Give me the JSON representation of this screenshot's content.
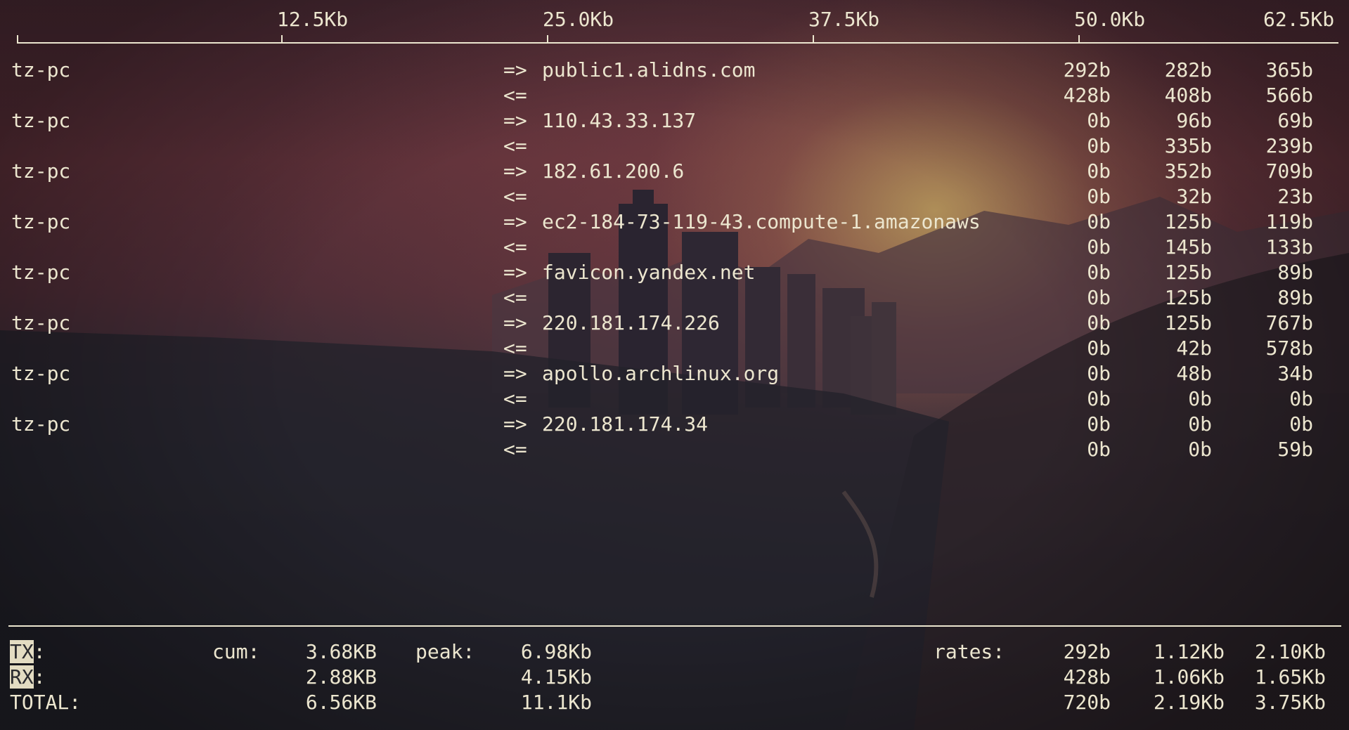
{
  "scale": {
    "labels": [
      "12.5Kb",
      "25.0Kb",
      "37.5Kb",
      "50.0Kb",
      "62.5Kb"
    ]
  },
  "connections": [
    {
      "host": "tz-pc",
      "tx_arrow": "=>",
      "rx_arrow": "<=",
      "remote": "public1.alidns.com",
      "tx": [
        "292b",
        "282b",
        "365b"
      ],
      "rx": [
        "428b",
        "408b",
        "566b"
      ]
    },
    {
      "host": "tz-pc",
      "tx_arrow": "=>",
      "rx_arrow": "<=",
      "remote": "110.43.33.137",
      "tx": [
        "0b",
        "96b",
        "69b"
      ],
      "rx": [
        "0b",
        "335b",
        "239b"
      ]
    },
    {
      "host": "tz-pc",
      "tx_arrow": "=>",
      "rx_arrow": "<=",
      "remote": "182.61.200.6",
      "tx": [
        "0b",
        "352b",
        "709b"
      ],
      "rx": [
        "0b",
        "32b",
        "23b"
      ]
    },
    {
      "host": "tz-pc",
      "tx_arrow": "=>",
      "rx_arrow": "<=",
      "remote": "ec2-184-73-119-43.compute-1.amazonaws",
      "tx": [
        "0b",
        "125b",
        "119b"
      ],
      "rx": [
        "0b",
        "145b",
        "133b"
      ]
    },
    {
      "host": "tz-pc",
      "tx_arrow": "=>",
      "rx_arrow": "<=",
      "remote": "favicon.yandex.net",
      "tx": [
        "0b",
        "125b",
        "89b"
      ],
      "rx": [
        "0b",
        "125b",
        "89b"
      ]
    },
    {
      "host": "tz-pc",
      "tx_arrow": "=>",
      "rx_arrow": "<=",
      "remote": "220.181.174.226",
      "tx": [
        "0b",
        "125b",
        "767b"
      ],
      "rx": [
        "0b",
        "42b",
        "578b"
      ]
    },
    {
      "host": "tz-pc",
      "tx_arrow": "=>",
      "rx_arrow": "<=",
      "remote": "apollo.archlinux.org",
      "tx": [
        "0b",
        "48b",
        "34b"
      ],
      "rx": [
        "0b",
        "0b",
        "0b"
      ]
    },
    {
      "host": "tz-pc",
      "tx_arrow": "=>",
      "rx_arrow": "<=",
      "remote": "220.181.174.34",
      "tx": [
        "0b",
        "0b",
        "0b"
      ],
      "rx": [
        "0b",
        "0b",
        "59b"
      ]
    }
  ],
  "totals": {
    "tx_label": "TX",
    "rx_label": "RX",
    "colon": ":",
    "total_label": "TOTAL:",
    "cum_label": "cum:",
    "peak_label": "peak:",
    "rates_label": "rates:",
    "tx": {
      "cum": "3.68KB",
      "peak": "6.98Kb",
      "rates": [
        "292b",
        "1.12Kb",
        "2.10Kb"
      ]
    },
    "rx": {
      "cum": "2.88KB",
      "peak": "4.15Kb",
      "rates": [
        "428b",
        "1.06Kb",
        "1.65Kb"
      ]
    },
    "total": {
      "cum": "6.56KB",
      "peak": "11.1Kb",
      "rates": [
        "720b",
        "2.19Kb",
        "3.75Kb"
      ]
    }
  },
  "colors": {
    "text": "#ece6cf",
    "highlight": "#e3dcc2"
  }
}
